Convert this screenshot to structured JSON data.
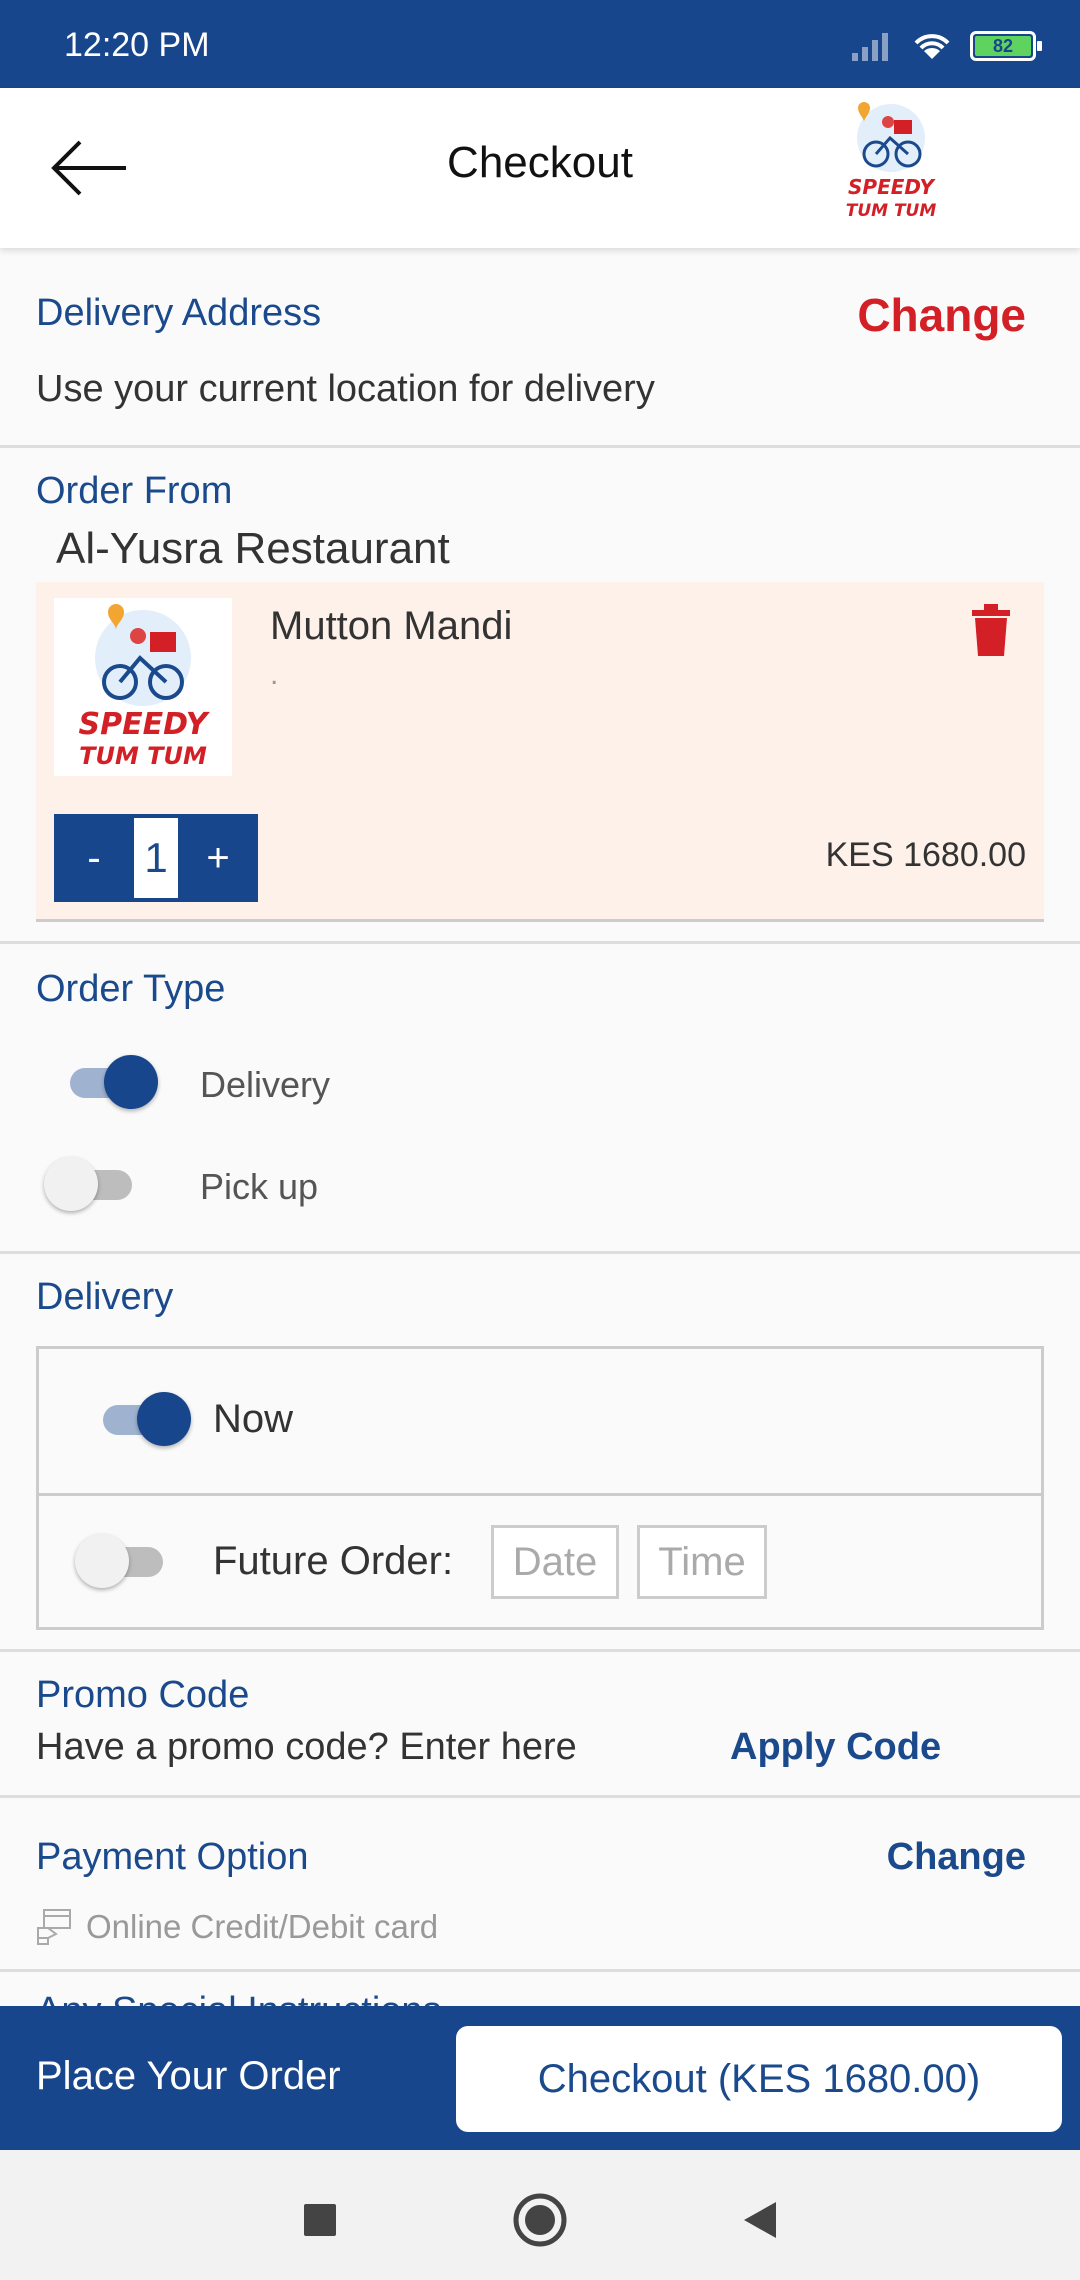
{
  "status_bar": {
    "time": "12:20 PM",
    "battery": "82"
  },
  "header": {
    "title": "Checkout",
    "logo_text_line1": "SPEEDY",
    "logo_text_line2": "TUM TUM"
  },
  "delivery_address": {
    "label": "Delivery Address",
    "change_label": "Change",
    "value": "Use your current location for delivery"
  },
  "order_from": {
    "label": "Order From",
    "restaurant": "Al-Yusra Restaurant",
    "item": {
      "name": "Mutton Mandi",
      "note": ".",
      "quantity": "1",
      "minus": "-",
      "plus": "+",
      "price": "KES 1680.00"
    }
  },
  "order_type": {
    "label": "Order Type",
    "options": [
      {
        "label": "Delivery",
        "on": true
      },
      {
        "label": "Pick up",
        "on": false
      }
    ]
  },
  "delivery": {
    "label": "Delivery",
    "now_label": "Now",
    "future_label": "Future Order:",
    "date_placeholder": "Date",
    "time_placeholder": "Time"
  },
  "promo": {
    "label": "Promo Code",
    "prompt": "Have a promo code? Enter here",
    "apply_label": "Apply Code"
  },
  "payment": {
    "label": "Payment Option",
    "change_label": "Change",
    "method": "Online Credit/Debit card",
    "icon": "card-payment-icon"
  },
  "special_instructions": {
    "label": "Any Special Instructions"
  },
  "bottom_bar": {
    "place_label": "Place Your Order",
    "checkout_label": "Checkout (KES 1680.00)"
  },
  "colors": {
    "primary": "#17468c",
    "accent_red": "#d32027",
    "item_bg": "#fdf1ea"
  }
}
